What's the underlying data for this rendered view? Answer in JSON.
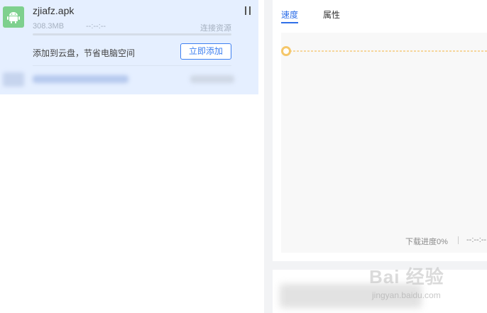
{
  "task": {
    "file_name": "zjiafz.apk",
    "file_size": "308.3MB",
    "time_left": "--:--:--",
    "status": "连接资源",
    "progress": 0,
    "cloud_tip": "添加到云盘，节省电脑空间",
    "add_button_label": "立即添加",
    "icon": "android-icon",
    "pause_icon": "pause-icon"
  },
  "detail": {
    "tabs": [
      {
        "label": "速度",
        "active": true
      },
      {
        "label": "属性",
        "active": false
      }
    ],
    "download_progress": "下载进度0%",
    "remaining_time": "--:--:--"
  },
  "watermark": {
    "main": "Bai 经验",
    "sub": "jingyan.baidu.com"
  },
  "colors": {
    "accent": "#2f6fe8",
    "card_bg": "#e5efff",
    "chart_line": "#f5b53f"
  }
}
